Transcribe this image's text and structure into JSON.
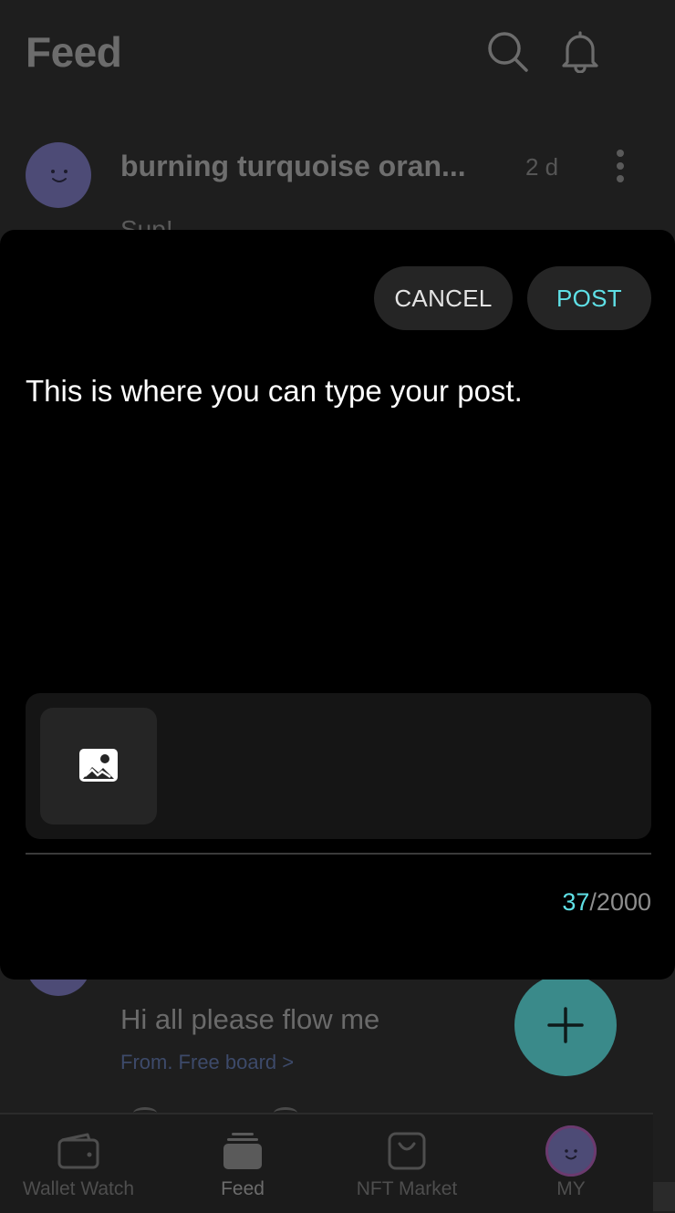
{
  "header": {
    "title": "Feed",
    "search_icon": "search-icon",
    "notifications_icon": "bell-icon"
  },
  "feed": {
    "posts": [
      {
        "author": "burning turquoise oran...",
        "time": "2 d",
        "body_preview": "Sup!"
      },
      {
        "body": "Hi all please flow me",
        "board": "From. Free board >"
      }
    ],
    "fab_icon": "plus-icon"
  },
  "compose": {
    "cancel_label": "CANCEL",
    "post_label": "POST",
    "text": "This is where you can type your post.",
    "add_image_icon": "image-icon",
    "char_count_current": "37",
    "char_count_max": "/2000",
    "accent_color": "#5fe0e6"
  },
  "bottom_nav": {
    "items": [
      {
        "label": "Wallet Watch",
        "icon": "wallet-icon"
      },
      {
        "label": "Feed",
        "icon": "feed-icon",
        "active": true
      },
      {
        "label": "NFT Market",
        "icon": "shopping-bag-icon"
      },
      {
        "label": "MY",
        "icon": "avatar"
      }
    ]
  }
}
